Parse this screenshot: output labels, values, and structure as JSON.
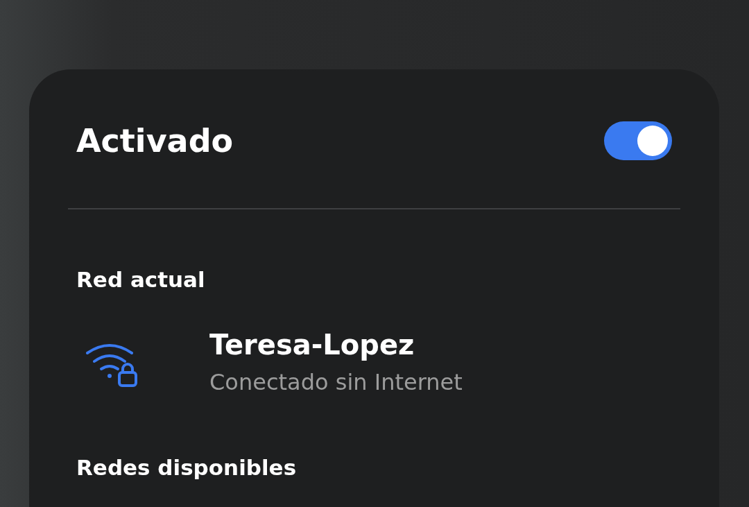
{
  "switch": {
    "label": "Activado",
    "on": true
  },
  "current_network": {
    "heading": "Red actual",
    "name": "Teresa-Lopez",
    "status": "Conectado sin Internet"
  },
  "available_networks": {
    "heading": "Redes disponibles"
  }
}
